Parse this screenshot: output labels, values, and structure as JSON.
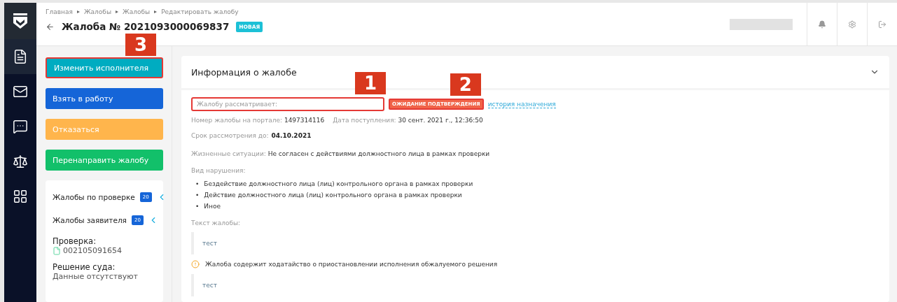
{
  "sidebar": {
    "items": [
      {
        "selected": true
      },
      {
        "selected": false
      },
      {
        "selected": false
      },
      {
        "selected": false
      },
      {
        "selected": false
      }
    ]
  },
  "header": {
    "breadcrumbs": [
      "Главная",
      "Жалобы",
      "Жалобы",
      "Редактировать жалобу"
    ],
    "title": "Жалоба № 2021093000069837",
    "status": "НОВАЯ"
  },
  "actions": [
    {
      "label": "Изменить исполнителя",
      "color": "#00acc1",
      "highlighted": true,
      "callout": "3"
    },
    {
      "label": "Взять в работу",
      "color": "#1565d8",
      "highlighted": false
    },
    {
      "label": "Отказаться",
      "color": "#ffb54c",
      "highlighted": false
    },
    {
      "label": "Перенаправить жалобу",
      "color": "#12c06a",
      "highlighted": false
    }
  ],
  "related": [
    {
      "label": "Жалобы по проверке",
      "count": "20"
    },
    {
      "label": "Жалобы заявителя",
      "count": "20"
    }
  ],
  "inspection": {
    "label": "Проверка:",
    "number": "002105091654"
  },
  "court": {
    "label": "Решение суда:",
    "value": "Данные отсутствуют"
  },
  "card": {
    "title": "Информация о жалобе",
    "expanded": true,
    "assignee": {
      "label": "Жалобу рассматривает:",
      "highlighted": true,
      "callout": "1"
    },
    "assignment_status": {
      "label": "ОЖИДАНИЕ ПОДТВЕРЖДЕНИЯ",
      "highlighted": true,
      "callout": "2"
    },
    "history_link": "история назначения",
    "portal_number": {
      "label": "Номер жалобы на портале:",
      "value": "1497314116"
    },
    "received": {
      "label": "Дата поступления:",
      "value": "30 сент. 2021 г., 12:36:50"
    },
    "deadline": {
      "label": "Срок рассмотрения до:",
      "value": "04.10.2021"
    },
    "situations": {
      "label": "Жизненные ситуации:",
      "value": "Не согласен с действиями должностного лица в рамках проверки"
    },
    "violation": {
      "label": "Вид нарушения:",
      "items": [
        {
          "marker": "•",
          "text": "Бездействие должностного лица (лиц) контрольного органа в рамках проверки"
        },
        {
          "marker": "•",
          "text": "Действие должностного лица (лиц) контрольного органа в рамках проверки"
        },
        {
          "marker": "•",
          "text": "Иное"
        }
      ]
    },
    "text": {
      "label": "Текст жалобы:",
      "value": "тест"
    },
    "petition": {
      "notice": "Жалоба содержит ходатайство о приостановлении исполнения обжалуемого решения",
      "value": "тест"
    }
  }
}
